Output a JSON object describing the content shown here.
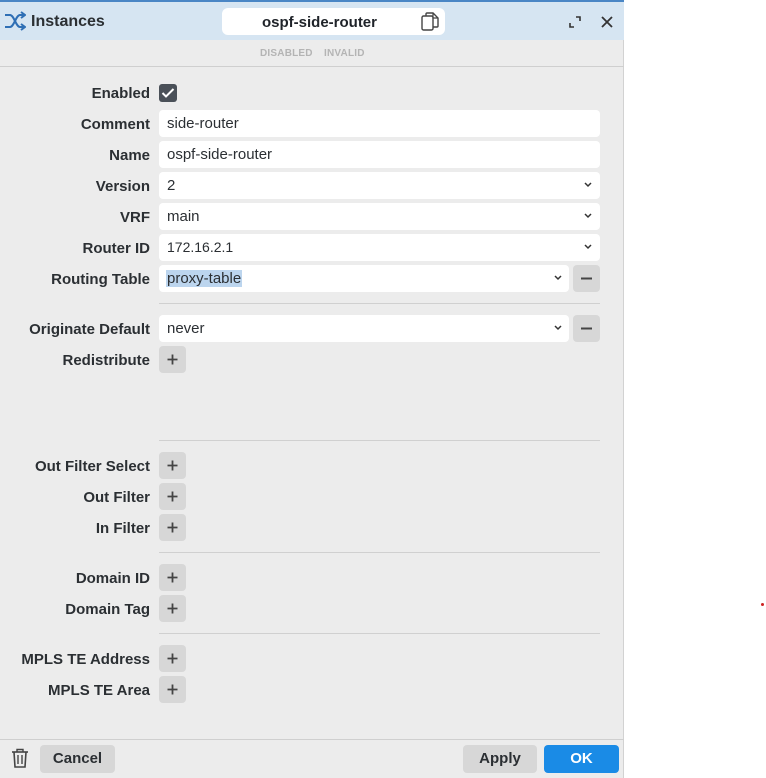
{
  "header": {
    "title": "Instances",
    "tab_title": "ospf-side-router"
  },
  "status_flags": {
    "disabled": "DISABLED",
    "invalid": "INVALID"
  },
  "form": {
    "enabled": {
      "label": "Enabled",
      "checked": true
    },
    "comment": {
      "label": "Comment",
      "value": "side-router"
    },
    "name": {
      "label": "Name",
      "value": "ospf-side-router"
    },
    "version": {
      "label": "Version",
      "value": "2"
    },
    "vrf": {
      "label": "VRF",
      "value": "main"
    },
    "router_id": {
      "label": "Router ID",
      "value": "172.16.2.1"
    },
    "routing_table": {
      "label": "Routing Table",
      "value": "proxy-table"
    },
    "originate_default": {
      "label": "Originate Default",
      "value": "never"
    },
    "redistribute": {
      "label": "Redistribute"
    },
    "out_filter_select": {
      "label": "Out Filter Select"
    },
    "out_filter": {
      "label": "Out Filter"
    },
    "in_filter": {
      "label": "In Filter"
    },
    "domain_id": {
      "label": "Domain ID"
    },
    "domain_tag": {
      "label": "Domain Tag"
    },
    "mpls_te_address": {
      "label": "MPLS TE Address"
    },
    "mpls_te_area": {
      "label": "MPLS TE Area"
    }
  },
  "footer": {
    "cancel_label": "Cancel",
    "apply_label": "Apply",
    "ok_label": "OK"
  },
  "icons": {
    "header": "shuffle-icon",
    "copy": "copy-icon",
    "expand": "expand-icon",
    "close": "close-icon",
    "dropdown": "chevron-down-icon",
    "add": "plus-icon",
    "remove": "minus-icon",
    "delete": "trash-icon",
    "checkbox": "check-icon"
  },
  "colors": {
    "header_bg": "#d6e5f2",
    "header_accent": "#4a86c5",
    "panel_bg": "#ececec",
    "primary_button": "#1a8be6",
    "selection": "#bcd5ee"
  }
}
